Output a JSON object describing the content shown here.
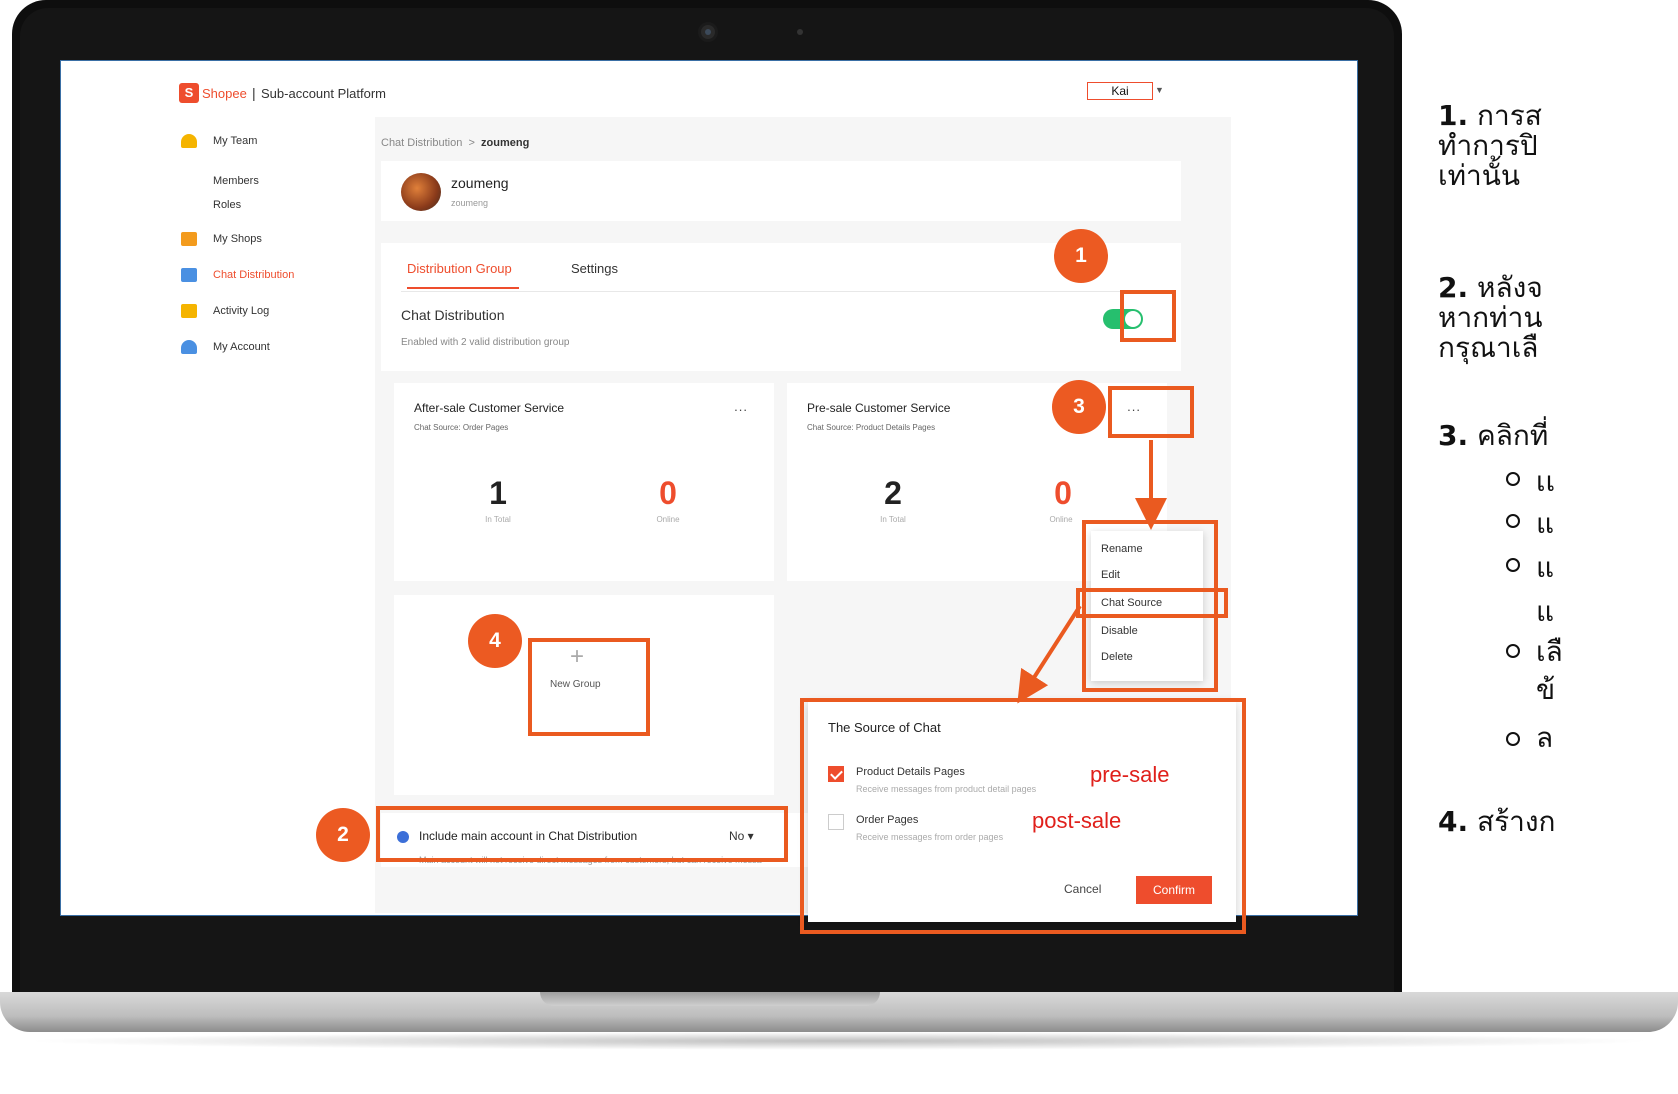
{
  "app": {
    "brand": "Shopee",
    "separator": "|",
    "platform_title": "Sub-account Platform",
    "user": "Kai"
  },
  "sidebar": {
    "items": [
      {
        "label": "My Team",
        "icon": "team-icon"
      },
      {
        "label": "Members"
      },
      {
        "label": "Roles"
      },
      {
        "label": "My Shops",
        "icon": "shop-icon"
      },
      {
        "label": "Chat Distribution",
        "icon": "chat-icon",
        "active": true
      },
      {
        "label": "Activity Log",
        "icon": "log-icon"
      },
      {
        "label": "My Account",
        "icon": "account-icon"
      }
    ]
  },
  "breadcrumb": {
    "parent": "Chat Distribution",
    "separator": ">",
    "current": "zoumeng"
  },
  "profile": {
    "name": "zoumeng",
    "username": "zoumeng"
  },
  "tabs": [
    "Distribution Group",
    "Settings"
  ],
  "chat_distribution": {
    "title": "Chat Distribution",
    "subtitle": "Enabled with 2 valid distribution group",
    "enabled": true
  },
  "groups": [
    {
      "title": "After-sale Customer Service",
      "source": "Chat Source: Order Pages",
      "total": "1",
      "total_label": "In Total",
      "online": "0",
      "online_label": "Online",
      "more": "..."
    },
    {
      "title": "Pre-sale Customer Service",
      "source": "Chat Source: Product Details Pages",
      "total": "2",
      "total_label": "In Total",
      "online": "0",
      "online_label": "Online",
      "more": "..."
    }
  ],
  "new_group": {
    "plus": "+",
    "label": "New Group"
  },
  "include_main": {
    "label": "Include main account in Chat Distribution",
    "value": "No",
    "note": "Main account will not receive direct messages from customers, but can receive messa"
  },
  "menu": [
    "Rename",
    "Edit",
    "Chat Source",
    "Disable",
    "Delete"
  ],
  "source_popup": {
    "title": "The Source of Chat",
    "options": [
      {
        "label": "Product Details Pages",
        "desc": "Receive messages from product detail pages",
        "checked": true,
        "tag": "pre-sale"
      },
      {
        "label": "Order Pages",
        "desc": "Receive messages from order pages",
        "checked": false,
        "tag": "post-sale"
      }
    ],
    "cancel": "Cancel",
    "confirm": "Confirm"
  },
  "badges": [
    "1",
    "2",
    "3",
    "4"
  ],
  "instructions": {
    "n1": "1.",
    "l1a": "การส",
    "l1b": "ทำการปิ",
    "l1c": "เท่านั้น",
    "n2": "2.",
    "l2a": "หลังจ",
    "l2b": "หากท่าน",
    "l2c": "กรุณาเลื",
    "n3": "3.",
    "l3a": "คลิกที่",
    "b1": "เเ",
    "b2": "แ",
    "b3a": "แ",
    "b3b": "แ",
    "b4a": "เลื",
    "b4b": "ข้",
    "b5": "ล",
    "n4": "4.",
    "l4a": "สร้างก"
  }
}
